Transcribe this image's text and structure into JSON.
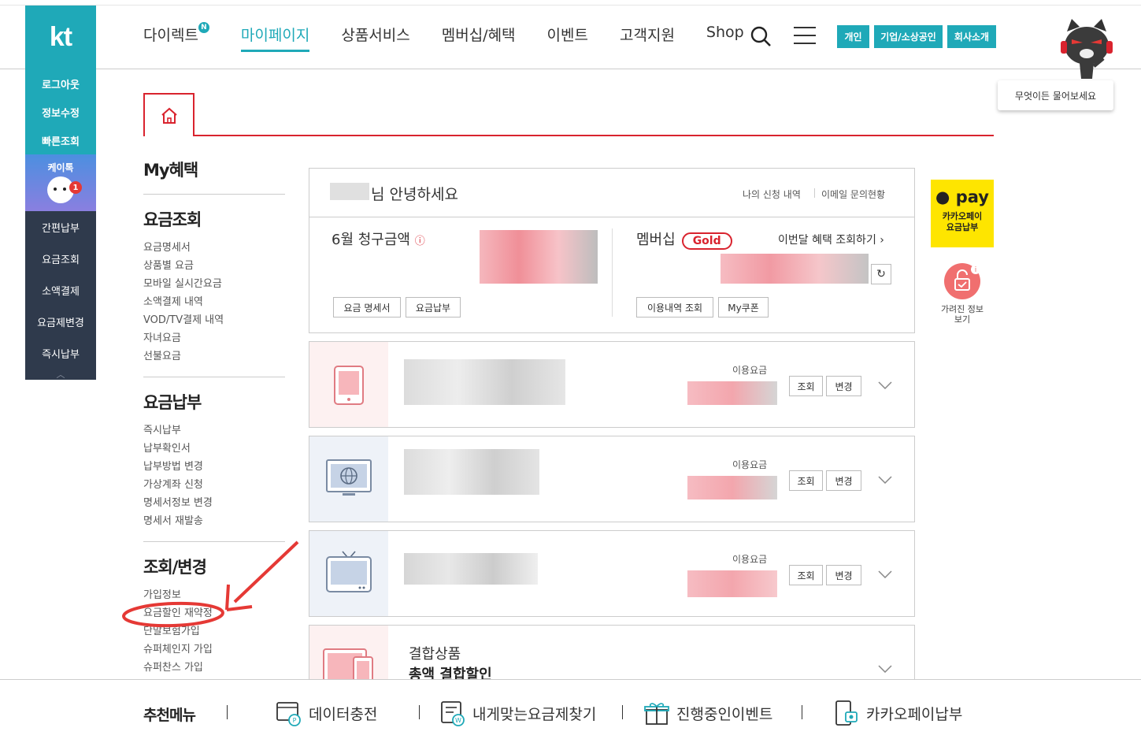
{
  "header": {
    "logo": "kt",
    "nav": [
      {
        "label": "다이렉트",
        "badge": "N"
      },
      {
        "label": "마이페이지",
        "active": true
      },
      {
        "label": "상품서비스"
      },
      {
        "label": "멤버십/혜택"
      },
      {
        "label": "이벤트"
      },
      {
        "label": "고객지원"
      },
      {
        "label": "Shop"
      }
    ],
    "pills": [
      "개인",
      "기업/소상공인",
      "회사소개"
    ],
    "ask": "무엇이든 물어보세요",
    "accent": "#1fa9b8"
  },
  "quick": {
    "top": [
      "로그아웃",
      "정보수정",
      "빠른조회"
    ],
    "ktalk": {
      "label": "케이톡",
      "badge": "1"
    },
    "bottom": [
      "간편납부",
      "요금조회",
      "소액결제",
      "요금제변경",
      "즉시납부"
    ]
  },
  "side": {
    "title": "My혜택",
    "sections": [
      {
        "title": "요금조회",
        "items": [
          "요금명세서",
          "상품별 요금",
          "모바일 실시간요금",
          "소액결제 내역",
          "VOD/TV결제 내역",
          "자녀요금",
          "선불요금"
        ]
      },
      {
        "title": "요금납부",
        "items": [
          "즉시납부",
          "납부확인서",
          "납부방법 변경",
          "가상계좌 신청",
          "명세서정보 변경",
          "명세서 재발송"
        ]
      },
      {
        "title": "조회/변경",
        "items": [
          "가입정보",
          "요금할인 재약정",
          "단말보험가입",
          "슈퍼체인지 가입",
          "슈퍼찬스 가입"
        ]
      }
    ]
  },
  "summary": {
    "greeting": "님 안녕하세요",
    "links": [
      "나의 신청 내역",
      "이메일 문의현황"
    ],
    "bill_title": "6월 청구금액",
    "bill_buttons": [
      "요금 명세서",
      "요금납부"
    ],
    "membership_label": "멤버십",
    "membership_grade": "Gold",
    "benefit_link": "이번달 혜택 조회하기",
    "member_buttons": [
      "이용내역 조회",
      "My쿠폰"
    ]
  },
  "services": [
    {
      "type": "mobile",
      "fee_label": "이용요금",
      "buttons": [
        "조회",
        "변경"
      ]
    },
    {
      "type": "internet",
      "fee_label": "이용요금",
      "buttons": [
        "조회",
        "변경"
      ]
    },
    {
      "type": "tv",
      "fee_label": "이용요금",
      "buttons": [
        "조회",
        "변경"
      ]
    }
  ],
  "bundle": {
    "title": "결합상품",
    "subtitle": "총액 결합할인"
  },
  "right": {
    "pay_logo": "pay",
    "pay_sub": [
      "카카오페이",
      "요금납부"
    ],
    "hidden": [
      "가려진 정보",
      "보기"
    ]
  },
  "bottom": {
    "title": "추천메뉴",
    "items": [
      "데이터충전",
      "내게맞는요금제찾기",
      "진행중인이벤트",
      "카카오페이납부"
    ]
  }
}
